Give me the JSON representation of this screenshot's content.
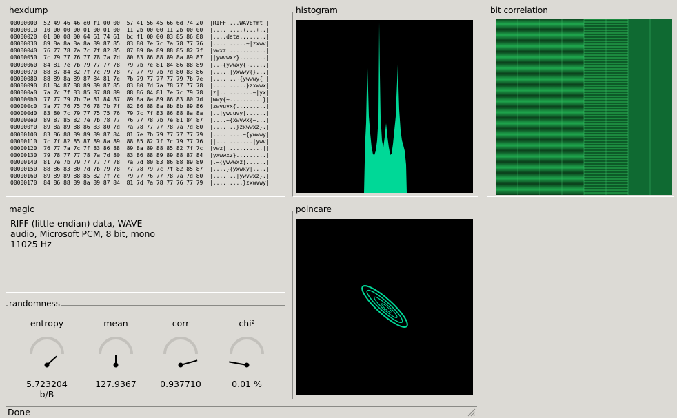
{
  "panels": {
    "hexdump": "hexdump",
    "histogram": "histogram",
    "bitcorr": "bit correlation",
    "magic": "magic",
    "poincare": "poincare",
    "randomness": "randomness"
  },
  "hexdump": {
    "lines": [
      "00000000  52 49 46 46 e0 f1 00 00  57 41 56 45 66 6d 74 20  |RIFF....WAVEfmt |",
      "00000010  10 00 00 00 01 00 01 00  11 2b 00 00 11 2b 00 00  |.........+...+..|",
      "00000020  01 00 08 00 64 61 74 61  bc f1 00 00 83 85 86 88  |....data........|",
      "00000030  89 8a 8a 8a 8a 89 87 85  83 80 7e 7c 7a 78 77 76  |..........~|zxwv|",
      "00000040  76 77 78 7a 7c 7f 82 85  87 89 8a 89 88 85 82 7f  |vwxz|...........|",
      "00000050  7c 79 77 76 77 78 7a 7d  80 83 86 88 89 8a 89 87  ||ywvwxz}........|",
      "00000060  84 81 7e 7b 79 77 77 78  79 7b 7e 81 84 86 88 89  |..~{ywwxy{~.....|",
      "00000070  88 87 84 82 7f 7c 79 78  77 77 79 7b 7d 80 83 86  |.....|yxwwy{}...|",
      "00000080  88 89 8a 89 87 84 81 7e  7b 79 77 77 77 79 7b 7e  |.......~{ywwwy{~|",
      "00000090  81 84 87 88 89 89 87 85  83 80 7d 7a 78 77 77 78  |..........}zxwwx|",
      "000000a0  7a 7c 7f 83 85 87 88 89  88 86 84 81 7e 7c 79 78  |z|..........~|yx|",
      "000000b0  77 77 79 7b 7e 81 84 87  89 8a 8a 89 86 83 80 7d  |wwy{~..........}|",
      "000000c0  7a 77 76 75 76 78 7b 7f  82 86 88 8a 8b 8b 89 86  |zwvuvx{.........|",
      "000000d0  83 80 7c 79 77 75 75 76  79 7c 7f 83 86 88 8a 8a  |..|ywuuvy|......|",
      "000000e0  89 87 85 82 7e 7b 78 77  76 77 78 7b 7e 81 84 87  |....~{xwvwx{~...|",
      "000000f0  89 8a 89 88 86 83 80 7d  7a 78 77 77 78 7a 7d 80  |.......}zxwwxz}.|",
      "00000100  83 86 88 89 89 89 87 84  81 7e 7b 79 77 77 77 79  |.........~{ywwwy|",
      "00000110  7c 7f 82 85 87 89 8a 89  88 85 82 7f 7c 79 77 76  ||...........|ywv|",
      "00000120  76 77 7a 7c 7f 83 86 88  89 8a 89 88 85 82 7f 7c  |vwz|...........||",
      "00000130  79 78 77 77 78 7a 7d 80  83 86 88 89 89 88 87 84  |yxwwxz}.........|",
      "00000140  81 7e 7b 79 77 77 77 78  7a 7d 80 83 86 88 89 89  |.~{ywwwxz}......|",
      "00000150  88 86 83 80 7d 7b 79 78  77 78 79 7c 7f 82 85 87  |....}{yxwxy|....|",
      "00000160  89 89 89 88 85 82 7f 7c  79 77 76 77 78 7a 7d 80  |.......|ywvwxz}.|",
      "00000170  84 86 88 89 8a 89 87 84  81 7d 7a 78 77 76 77 79  |.........}zxwvwy|"
    ]
  },
  "magic": {
    "line1": "RIFF (little-endian) data, WAVE",
    "line2": "audio, Microsoft PCM, 8 bit, mono",
    "line3": "11025 Hz"
  },
  "randomness": {
    "entropy": {
      "label": "entropy",
      "value": "5.723204 b/B",
      "level": 0.72
    },
    "mean": {
      "label": "mean",
      "value": "127.9367",
      "level": 0.5
    },
    "corr": {
      "label": "corr",
      "value": "0.937710",
      "level": 0.94
    },
    "chi": {
      "label": "chi²",
      "value": "0.01 %",
      "level": 0.0
    }
  },
  "status": {
    "text": "Done"
  },
  "colors": {
    "accent": "#00d897",
    "panel_bg": "#000000",
    "bitcorr_bg": "#006030"
  }
}
